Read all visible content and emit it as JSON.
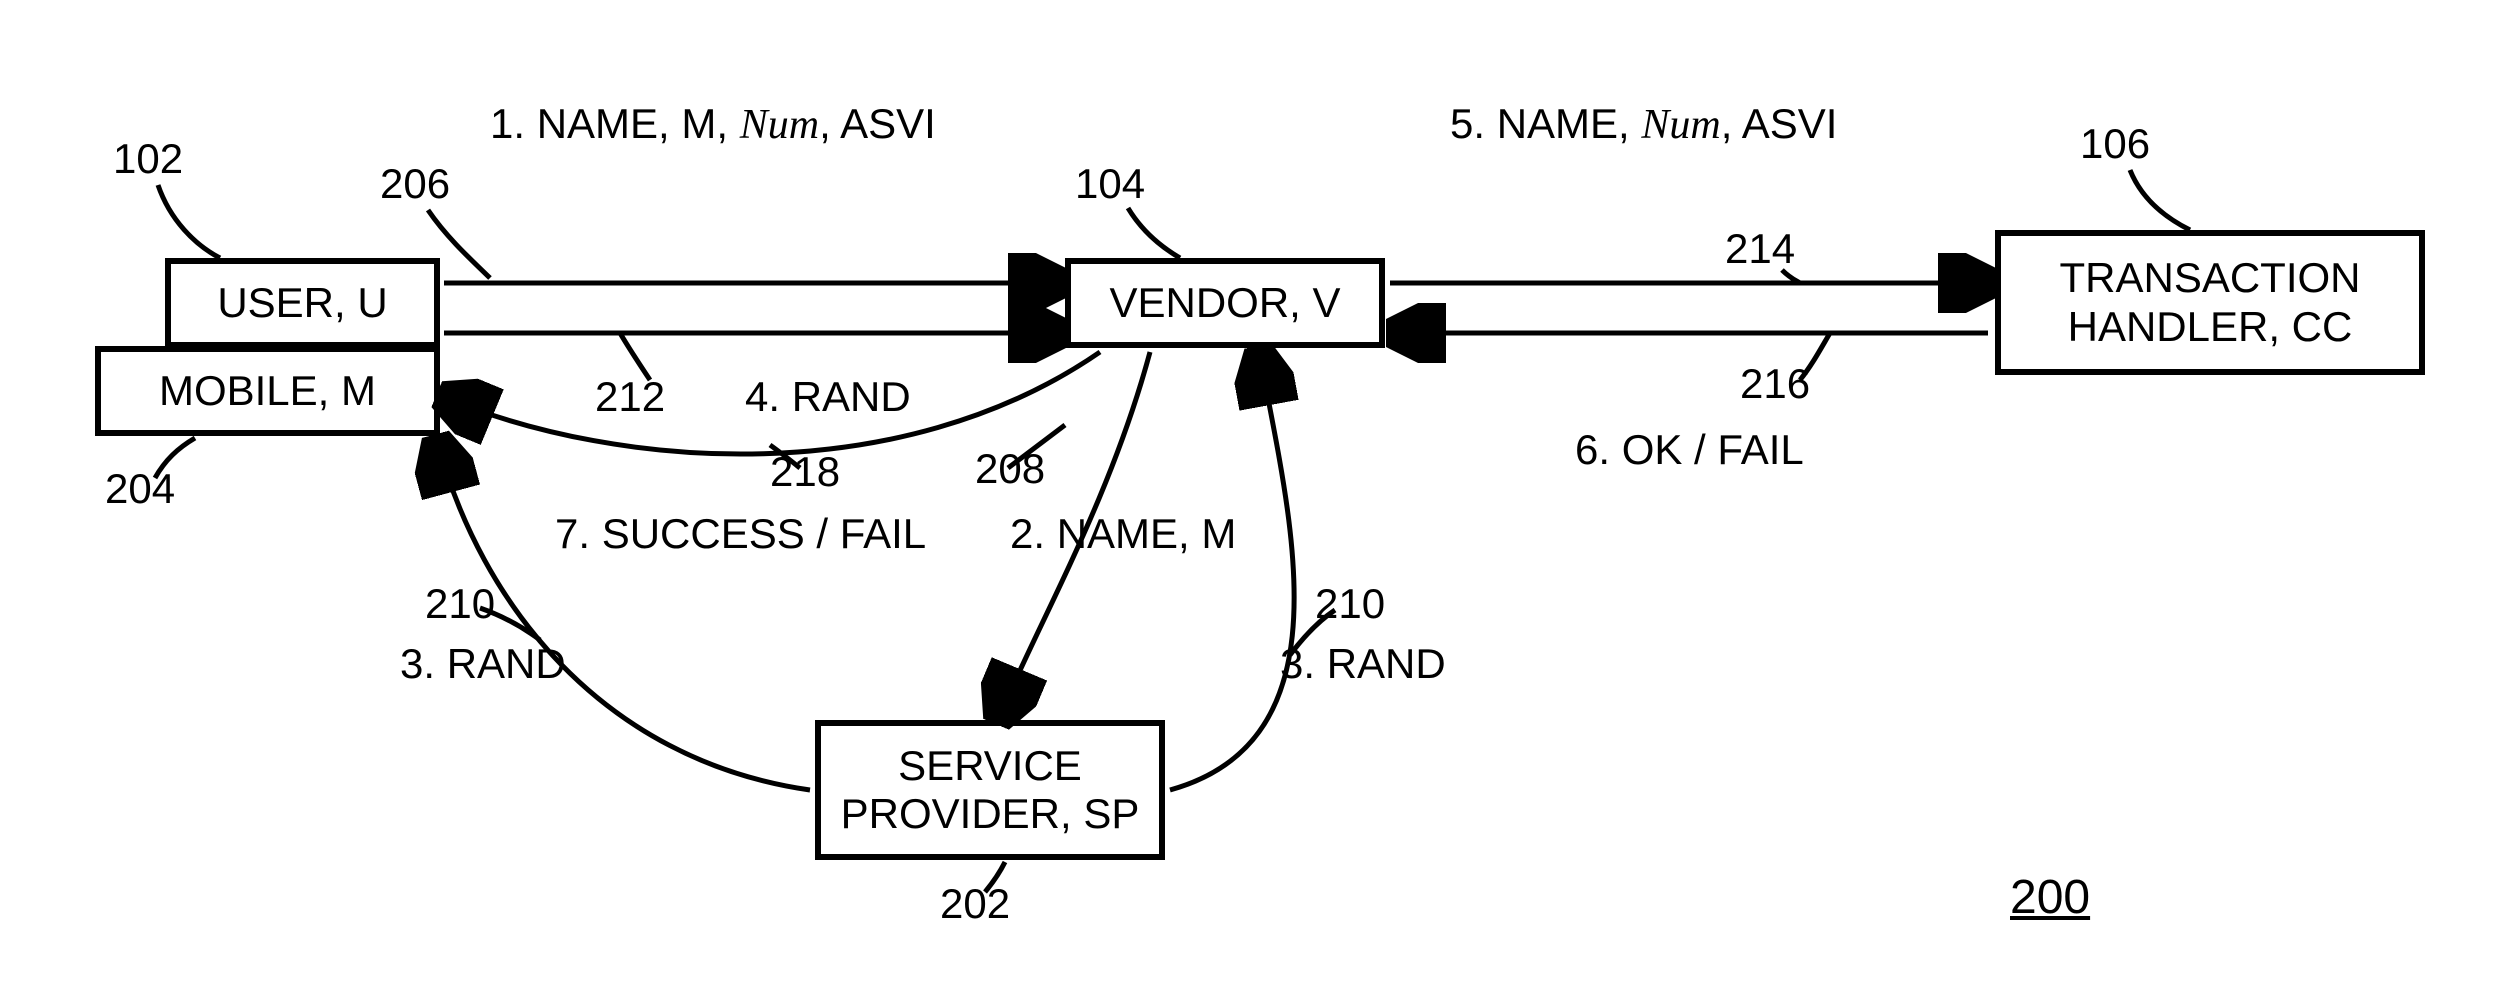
{
  "boxes": {
    "user": {
      "text": "USER, U"
    },
    "mobile": {
      "text": "MOBILE, M"
    },
    "vendor": {
      "text": "VENDOR, V"
    },
    "cc": {
      "text": "TRANSACTION\nHANDLER, CC"
    },
    "sp": {
      "text": "SERVICE\nPROVIDER, SP"
    }
  },
  "msgs": {
    "m1_prefix": "1. NAME, M, ",
    "m1_num": "Num",
    "m1_suffix": ",  ASVI",
    "m2": "2. NAME, M",
    "m3": "3. RAND",
    "m4": "4. RAND",
    "m5_prefix": "5. NAME, ",
    "m5_num": "Num",
    "m5_suffix": ",  ASVI",
    "m6": "6. OK / FAIL",
    "m7": "7. SUCCESS / FAIL"
  },
  "refs": {
    "r102": "102",
    "r104": "104",
    "r106": "106",
    "r200": "200",
    "r202": "202",
    "r204": "204",
    "r206": "206",
    "r208": "208",
    "r210": "210",
    "r212": "212",
    "r214": "214",
    "r216": "216",
    "r218": "218"
  }
}
